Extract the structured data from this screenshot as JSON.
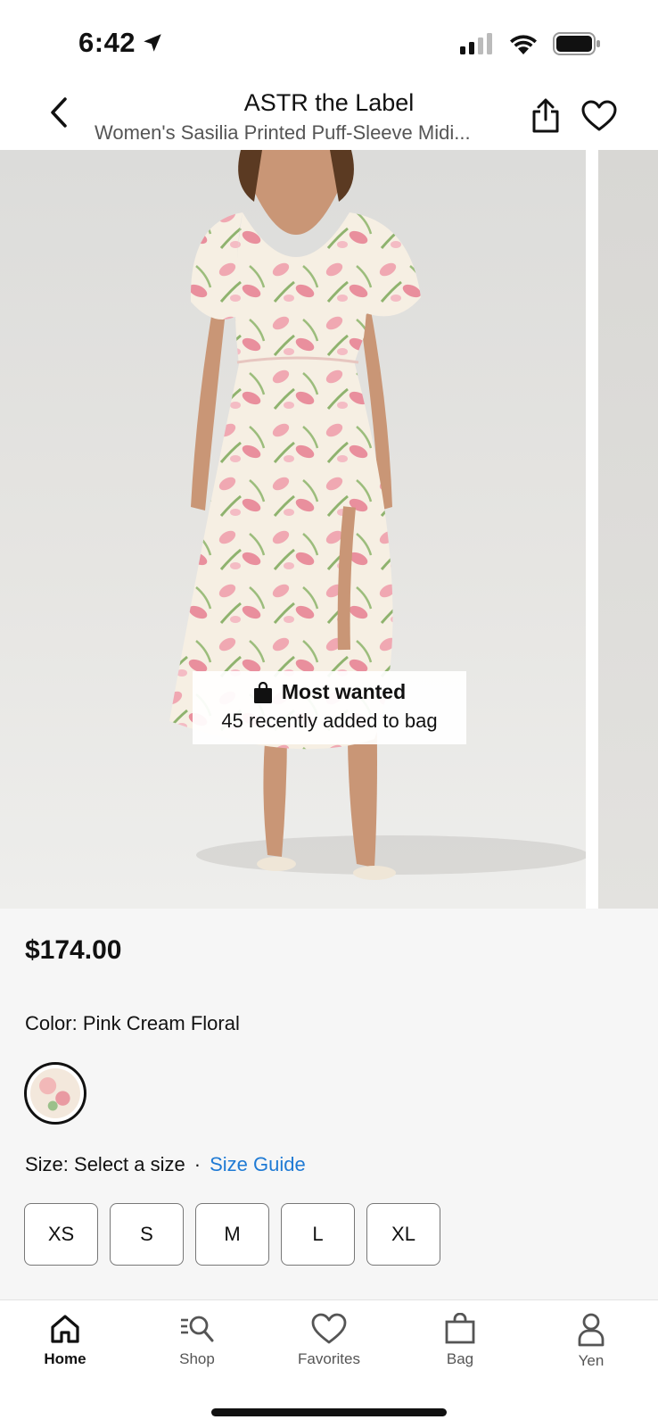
{
  "status_bar": {
    "time": "6:42"
  },
  "header": {
    "brand": "ASTR the Label",
    "product_name": "Women's Sasilia Printed Puff-Sleeve Midi..."
  },
  "badge": {
    "title": "Most wanted",
    "subtitle": "45 recently added to bag"
  },
  "product": {
    "price": "$174.00",
    "color_label": "Color:",
    "color_value": "Pink Cream Floral",
    "size_label": "Size: Select a size",
    "separator": "·",
    "size_guide": "Size Guide",
    "sizes": [
      "XS",
      "S",
      "M",
      "L",
      "XL"
    ]
  },
  "tabs": [
    {
      "label": "Home",
      "icon": "home-icon",
      "active": true
    },
    {
      "label": "Shop",
      "icon": "search-icon",
      "active": false
    },
    {
      "label": "Favorites",
      "icon": "heart-icon",
      "active": false
    },
    {
      "label": "Bag",
      "icon": "bag-icon",
      "active": false
    },
    {
      "label": "Yen",
      "icon": "profile-icon",
      "active": false
    }
  ],
  "colors": {
    "accent_link": "#1f7ad4",
    "details_bg": "#f6f6f6",
    "text": "#111111"
  }
}
